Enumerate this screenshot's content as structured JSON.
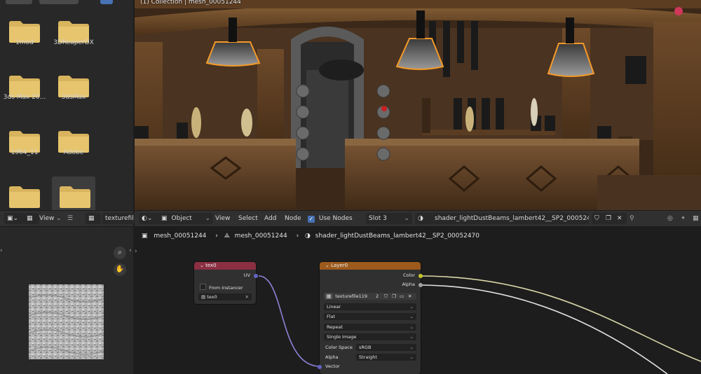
{
  "file_browser": {
    "folders": [
      {
        "label": "1mod"
      },
      {
        "label": "3DReaperDX"
      },
      {
        "label": "3ds Max 20..."
      },
      {
        "label": "3dsMax"
      },
      {
        "label": "1964_11"
      },
      {
        "label": "Adobe"
      },
      {
        "label": ""
      },
      {
        "label": ""
      }
    ]
  },
  "viewport": {
    "title": "(1) Collection | mesh_00051244"
  },
  "image_editor_header": {
    "view_label": "View",
    "image_name": "texturefil"
  },
  "node_editor_header": {
    "mode_label": "Object",
    "menus": [
      "View",
      "Select",
      "Add",
      "Node"
    ],
    "use_nodes_label": "Use Nodes",
    "use_nodes_checked": true,
    "slot_label": "Slot 3",
    "material_name": "shader_lightDustBeams_lambert42__SP2_00052470"
  },
  "breadcrumb": {
    "object": "mesh_00051244",
    "mesh": "mesh_00051244",
    "material": "shader_lightDustBeams_lambert42__SP2_00052470"
  },
  "nodes": {
    "tex0": {
      "title": "tex0",
      "output_uv": "UV",
      "from_instancer": "From Instancer",
      "uv_map": "tex0"
    },
    "layer0": {
      "title": "Layer0",
      "output_color": "Color",
      "output_alpha": "Alpha",
      "image_name": "texturefile119",
      "user_count": "2",
      "interpolation": "Linear",
      "projection": "Flat",
      "extension": "Repeat",
      "source": "Single Image",
      "color_space_label": "Color Space",
      "color_space_value": "sRGB",
      "alpha_label": "Alpha",
      "alpha_value": "Straight",
      "input_vector": "Vector"
    }
  },
  "colors": {
    "folder": "#d9b45e",
    "header_bg": "#303030",
    "tex_coord_header": "#8b2f43",
    "image_tex_header": "#9c5a1d",
    "socket_yellow": "#c7c729",
    "socket_grey": "#a1a1a1",
    "socket_purple": "#6363c7",
    "lamp_outline": "#f39a2a",
    "accent_blue": "#4772b3"
  }
}
